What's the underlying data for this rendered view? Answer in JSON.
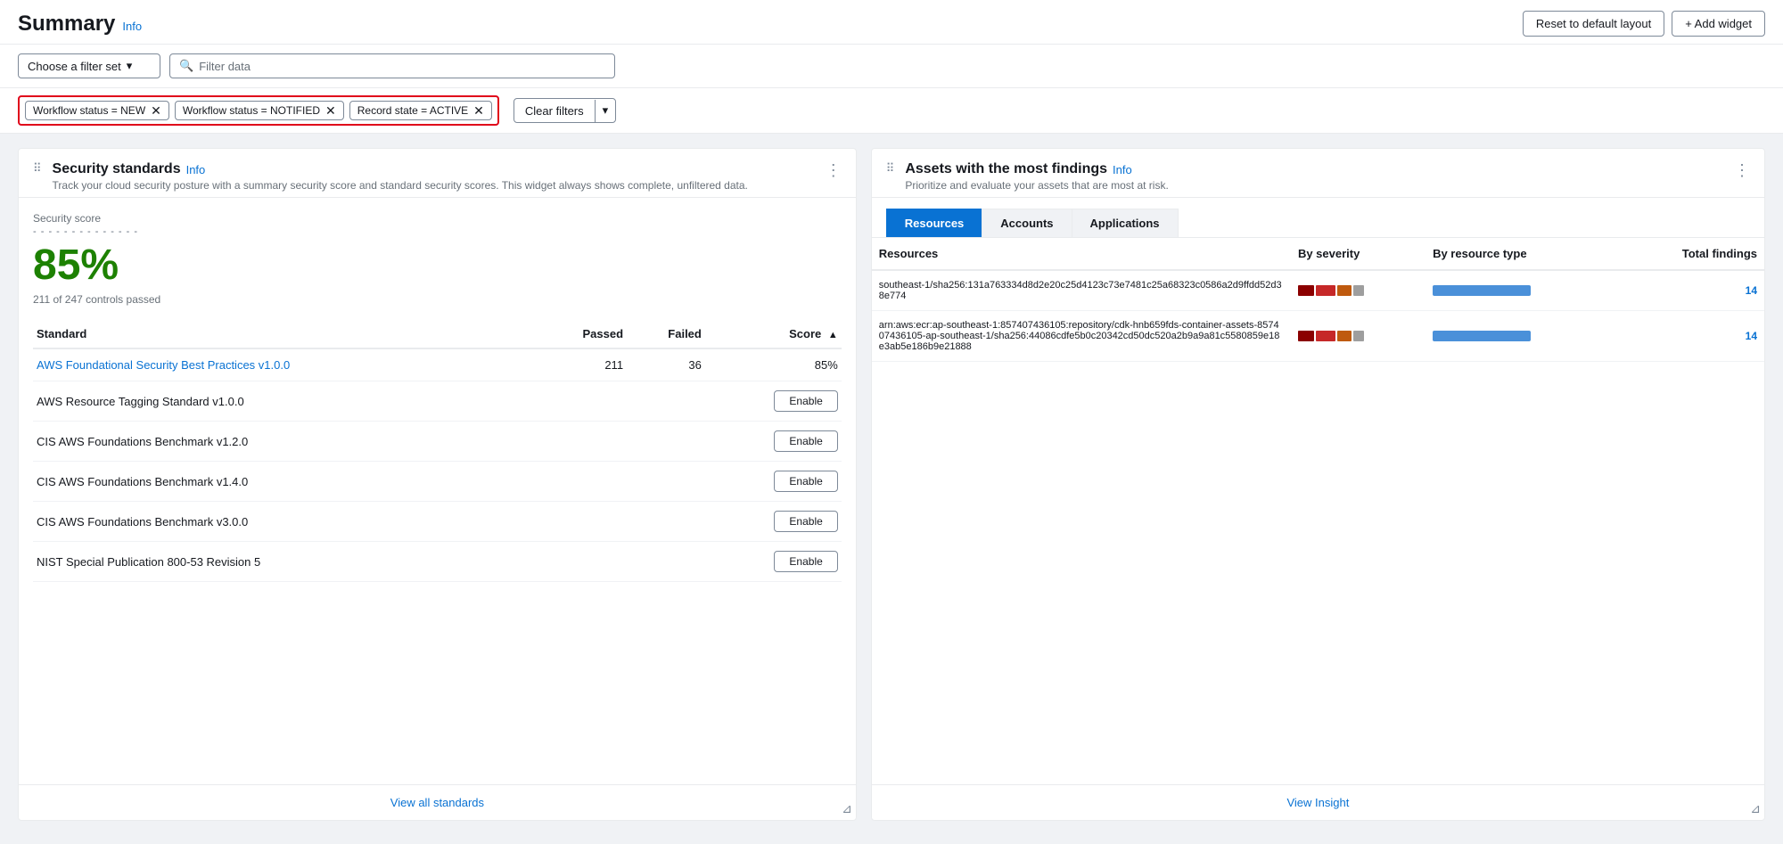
{
  "header": {
    "title": "Summary",
    "info_link": "Info",
    "reset_button": "Reset to default layout",
    "add_widget_button": "+ Add widget"
  },
  "filter_bar": {
    "filter_set_placeholder": "Choose a filter set",
    "search_placeholder": "Filter data"
  },
  "active_filters": {
    "filter1": "Workflow status = NEW",
    "filter2": "Workflow status = NOTIFIED",
    "filter3": "Record state = ACTIVE",
    "clear_button": "Clear filters"
  },
  "security_standards": {
    "widget_title": "Security standards",
    "info_link": "Info",
    "widget_subtitle": "Track your cloud security posture with a summary security score and standard security scores. This widget always shows complete, unfiltered data.",
    "score_label": "Security score",
    "score_value": "85%",
    "controls_passed": "211 of 247 controls passed",
    "col_standard": "Standard",
    "col_passed": "Passed",
    "col_failed": "Failed",
    "col_score": "Score",
    "standards": [
      {
        "name": "AWS Foundational Security Best Practices v1.0.0",
        "passed": "211",
        "failed": "36",
        "score": "85%",
        "is_link": true,
        "has_enable": false
      },
      {
        "name": "AWS Resource Tagging Standard v1.0.0",
        "passed": "",
        "failed": "",
        "score": "",
        "is_link": false,
        "has_enable": true
      },
      {
        "name": "CIS AWS Foundations Benchmark v1.2.0",
        "passed": "",
        "failed": "",
        "score": "",
        "is_link": false,
        "has_enable": true
      },
      {
        "name": "CIS AWS Foundations Benchmark v1.4.0",
        "passed": "",
        "failed": "",
        "score": "",
        "is_link": false,
        "has_enable": true
      },
      {
        "name": "CIS AWS Foundations Benchmark v3.0.0",
        "passed": "",
        "failed": "",
        "score": "",
        "is_link": false,
        "has_enable": true
      },
      {
        "name": "NIST Special Publication 800-53 Revision 5",
        "passed": "",
        "failed": "",
        "score": "",
        "is_link": false,
        "has_enable": true
      }
    ],
    "enable_label": "Enable",
    "view_all": "View all standards"
  },
  "assets_widget": {
    "widget_title": "Assets with the most findings",
    "info_link": "Info",
    "widget_subtitle": "Prioritize and evaluate your assets that are most at risk.",
    "tabs": [
      "Resources",
      "Accounts",
      "Applications"
    ],
    "active_tab": 0,
    "col_resources": "Resources",
    "col_severity": "By severity",
    "col_resource_type": "By resource type",
    "col_total": "Total findings",
    "view_insight": "View Insight",
    "rows": [
      {
        "name": "southeast-1/sha256:131a763334d8d2e20c25d4123c73e7481c25a68323c0586a2d9ffdd52d38e774",
        "severity_bars": [
          {
            "color": "#8b0000",
            "width": 18
          },
          {
            "color": "#c62828",
            "width": 22
          },
          {
            "color": "#bf5a0e",
            "width": 16
          },
          {
            "color": "#9e9e9e",
            "width": 12
          }
        ],
        "resource_bar_width": 110,
        "total": "14"
      },
      {
        "name": "arn:aws:ecr:ap-southeast-1:857407436105:repository/cdk-hnb659fds-container-assets-857407436105-ap-southeast-1/sha256:44086cdfe5b0c20342cd50dc520a2b9a9a81c5580859e18e3ab5e186b9e21888",
        "severity_bars": [
          {
            "color": "#8b0000",
            "width": 18
          },
          {
            "color": "#c62828",
            "width": 22
          },
          {
            "color": "#bf5a0e",
            "width": 16
          },
          {
            "color": "#9e9e9e",
            "width": 12
          }
        ],
        "resource_bar_width": 110,
        "total": "14"
      }
    ]
  }
}
